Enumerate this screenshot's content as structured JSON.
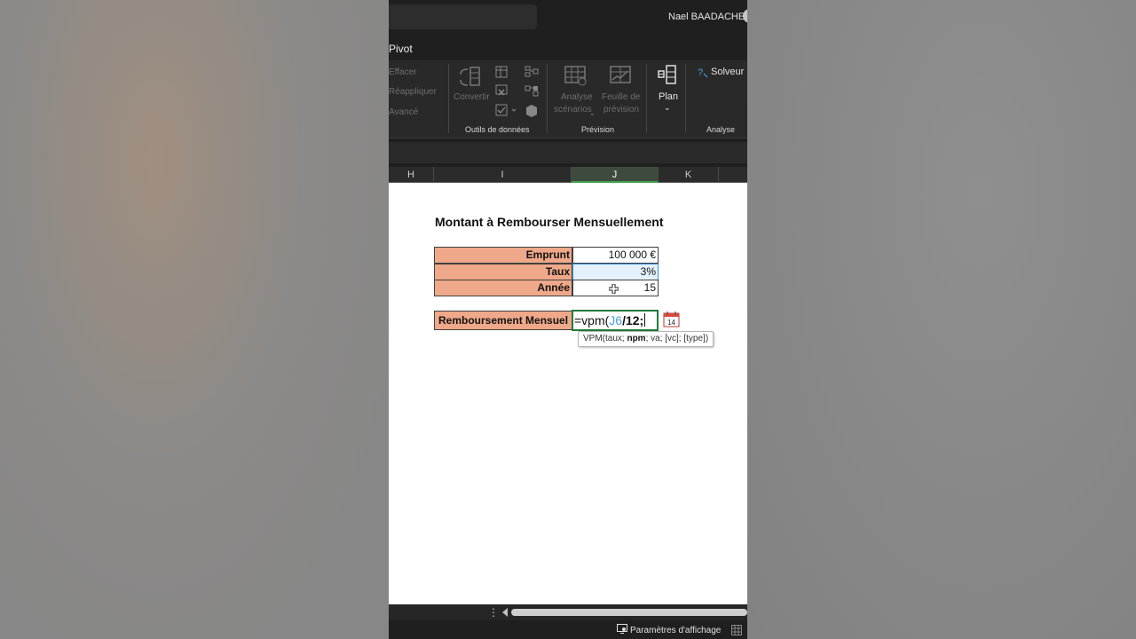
{
  "titlebar": {
    "user_name": "Nael BAADACHE"
  },
  "tabs": {
    "active": "Pivot"
  },
  "ribbon": {
    "sort_filter": {
      "clear": "Effacer",
      "reapply": "Réappliquer",
      "advanced": "Avancé"
    },
    "data_tools": {
      "convert": "Convertir",
      "group_label": "Outils de données"
    },
    "forecast": {
      "whatif_line1": "Analyse",
      "whatif_line2": "scénarios",
      "sheet_line1": "Feuille de",
      "sheet_line2": "prévision",
      "group_label": "Prévision"
    },
    "outline": {
      "label": "Plan"
    },
    "analysis": {
      "solver": "Solveur",
      "group_label": "Analyse"
    }
  },
  "columns": [
    "H",
    "I",
    "J",
    "K"
  ],
  "sheet": {
    "title": "Montant à Rembourser Mensuellement",
    "rows": [
      {
        "label": "Emprunt",
        "value": "100 000 €"
      },
      {
        "label": "Taux",
        "value": "3%"
      },
      {
        "label": "Année",
        "value": "15"
      }
    ],
    "repayment_label": "Remboursement Mensuel",
    "formula": {
      "prefix": "=vpm(",
      "ref": "J6",
      "suffix": "/12;"
    },
    "tooltip": {
      "fn": "VPM(taux; ",
      "bold_arg": "npm",
      "rest": "; va; [vc]; [type])"
    },
    "calendar_day": "14"
  },
  "statusbar": {
    "display_settings": "Paramètres d'affichage"
  },
  "colors": {
    "label_fill": "#efa889",
    "active_cell_border": "#227a3a",
    "ref_blue": "#4aa1e0"
  }
}
